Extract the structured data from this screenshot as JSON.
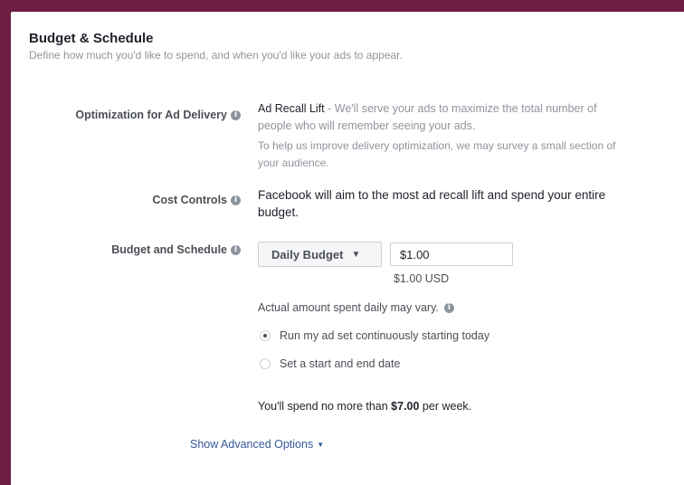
{
  "section": {
    "title": "Budget & Schedule",
    "subtitle": "Define how much you'd like to spend, and when you'd like your ads to appear."
  },
  "optimization": {
    "label": "Optimization for Ad Delivery",
    "value_name": "Ad Recall Lift",
    "value_desc": " - We'll serve your ads to maximize the total number of people who will remember seeing your ads.",
    "survey_note": "To help us improve delivery optimization, we may survey a small section of your audience."
  },
  "cost_controls": {
    "label": "Cost Controls",
    "text": "Facebook will aim to the most ad recall lift and spend your entire budget."
  },
  "budget": {
    "label": "Budget and Schedule",
    "type_selected": "Daily Budget",
    "amount_value": "$1.00",
    "amount_currency_note": "$1.00 USD",
    "vary_note": "Actual amount spent daily may vary.",
    "schedule_options": [
      {
        "label": "Run my ad set continuously starting today",
        "checked": true
      },
      {
        "label": "Set a start and end date",
        "checked": false
      }
    ],
    "spend_prefix": "You'll spend no more than ",
    "spend_amount": "$7.00",
    "spend_suffix": " per week."
  },
  "advanced": {
    "label": "Show Advanced Options"
  },
  "icons": {
    "info": "info-icon",
    "dropdown": "caret-down-icon"
  },
  "colors": {
    "frame": "#6e1f43",
    "link": "#365899"
  }
}
